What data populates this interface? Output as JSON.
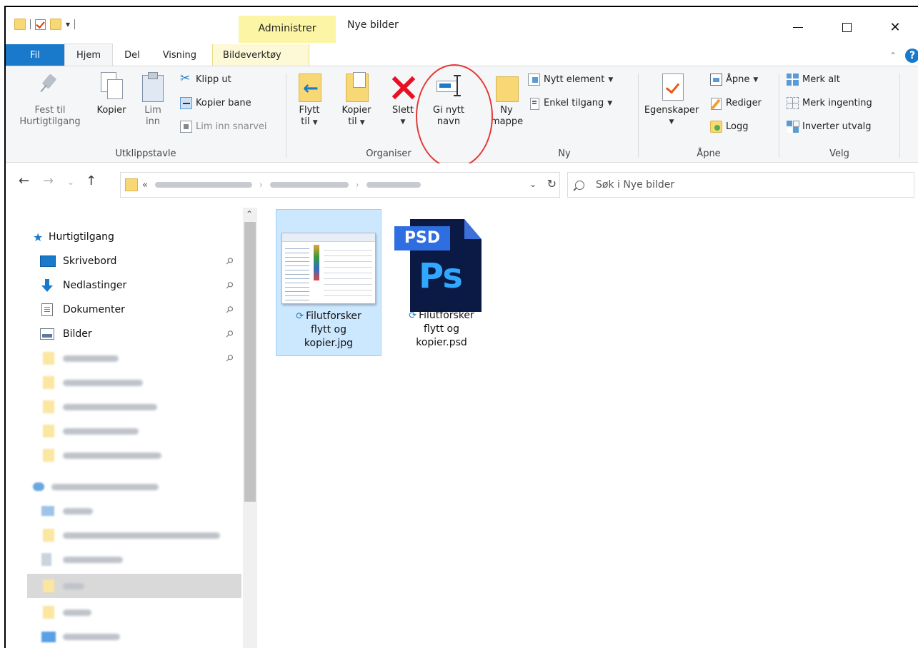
{
  "window": {
    "title": "Nye bilder",
    "contextual_tab_header": "Administrer"
  },
  "ribbon_tabs": [
    {
      "label": "Fil"
    },
    {
      "label": "Hjem"
    },
    {
      "label": "Del"
    },
    {
      "label": "Visning"
    },
    {
      "label": "Bildeverktøy"
    }
  ],
  "groups": {
    "clipboard": {
      "label": "Utklippstavle",
      "pin_line1": "Fest til",
      "pin_line2": "Hurtigtilgang",
      "copy": "Kopier",
      "paste_line1": "Lim",
      "paste_line2": "inn",
      "cut": "Klipp ut",
      "copy_path": "Kopier bane",
      "paste_shortcut": "Lim inn snarvei"
    },
    "organize": {
      "label": "Organiser",
      "move_line1": "Flytt",
      "move_line2": "til",
      "copyto_line1": "Kopier",
      "copyto_line2": "til",
      "delete": "Slett",
      "rename_line1": "Gi nytt",
      "rename_line2": "navn"
    },
    "new": {
      "label": "Ny",
      "folder_line1": "Ny",
      "folder_line2": "mappe",
      "new_item": "Nytt element",
      "easy_access": "Enkel tilgang"
    },
    "open": {
      "label": "Åpne",
      "properties": "Egenskaper",
      "open": "Åpne",
      "edit": "Rediger",
      "history": "Logg"
    },
    "select": {
      "label": "Velg",
      "select_all": "Merk alt",
      "select_none": "Merk ingenting",
      "invert": "Inverter utvalg"
    }
  },
  "address": {
    "overflow": "«"
  },
  "search": {
    "placeholder": "Søk i Nye bilder"
  },
  "nav_pane": {
    "quick_access": "Hurtigtilgang",
    "items": [
      {
        "label": "Skrivebord",
        "icon": "desktop-icon"
      },
      {
        "label": "Nedlastinger",
        "icon": "download-icon"
      },
      {
        "label": "Dokumenter",
        "icon": "documents-icon"
      },
      {
        "label": "Bilder",
        "icon": "pictures-icon"
      }
    ]
  },
  "files": [
    {
      "line1": "Filutforsker",
      "line2": "flytt og",
      "line3": "kopier.jpg",
      "selected": true
    },
    {
      "line1": "Filutforsker",
      "line2": "flytt og",
      "line3": "kopier.psd",
      "selected": false
    }
  ],
  "psd_icon": {
    "tag": "PSD",
    "mark": "Ps"
  },
  "colors": {
    "accent": "#1979ca",
    "contextual_tab": "#fcf5a5",
    "selection": "#cce8ff",
    "annotation": "#e53935"
  }
}
